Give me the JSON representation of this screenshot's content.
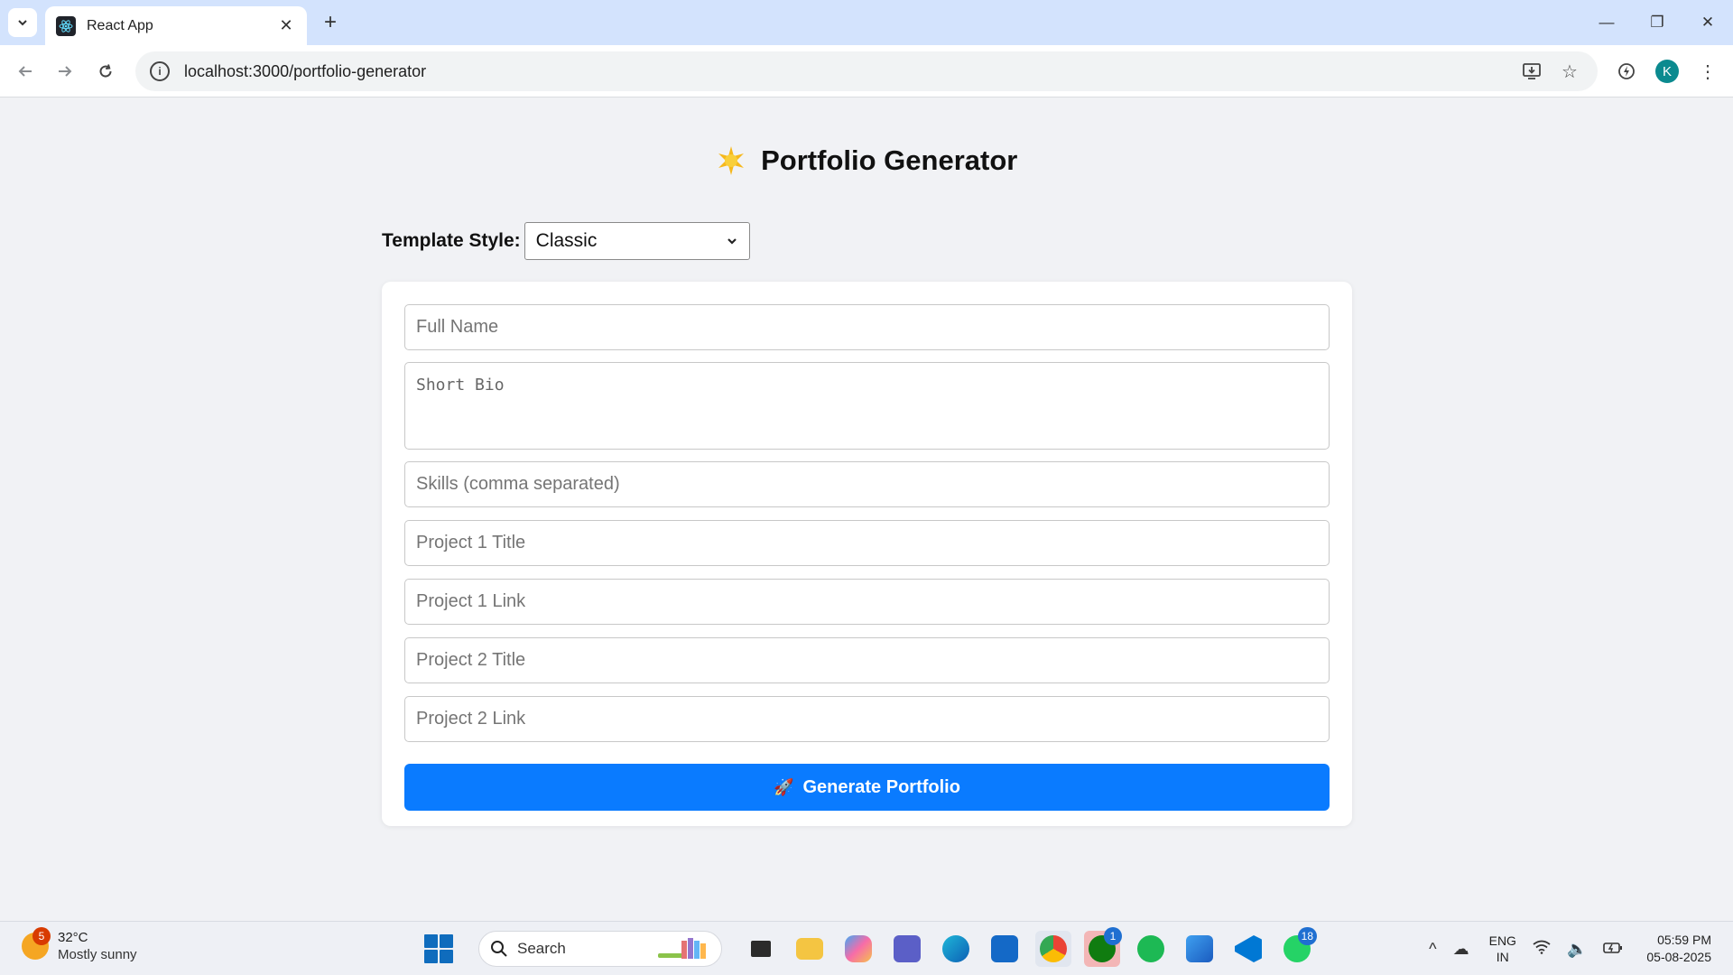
{
  "browser": {
    "tab_title": "React App",
    "url": "localhost:3000/portfolio-generator",
    "profile_initial": "K"
  },
  "page": {
    "title": "Portfolio Generator",
    "template_label": "Template Style:",
    "template_selected": "Classic",
    "fields": {
      "full_name": "Full Name",
      "short_bio": "Short Bio",
      "skills": "Skills (comma separated)",
      "project1_title": "Project 1 Title",
      "project1_link": "Project 1 Link",
      "project2_title": "Project 2 Title",
      "project2_link": "Project 2 Link"
    },
    "generate_button": "Generate Portfolio"
  },
  "taskbar": {
    "weather_temp": "32°C",
    "weather_desc": "Mostly sunny",
    "weather_badge": "5",
    "search_label": "Search",
    "xbox_badge": "1",
    "whatsapp_badge": "18",
    "lang_top": "ENG",
    "lang_bottom": "IN",
    "time": "05:59 PM",
    "date": "05-08-2025"
  },
  "colors": {
    "accent_button": "#0a7bff",
    "page_bg": "#f1f2f5",
    "tabbar_bg": "#d3e3fd"
  }
}
